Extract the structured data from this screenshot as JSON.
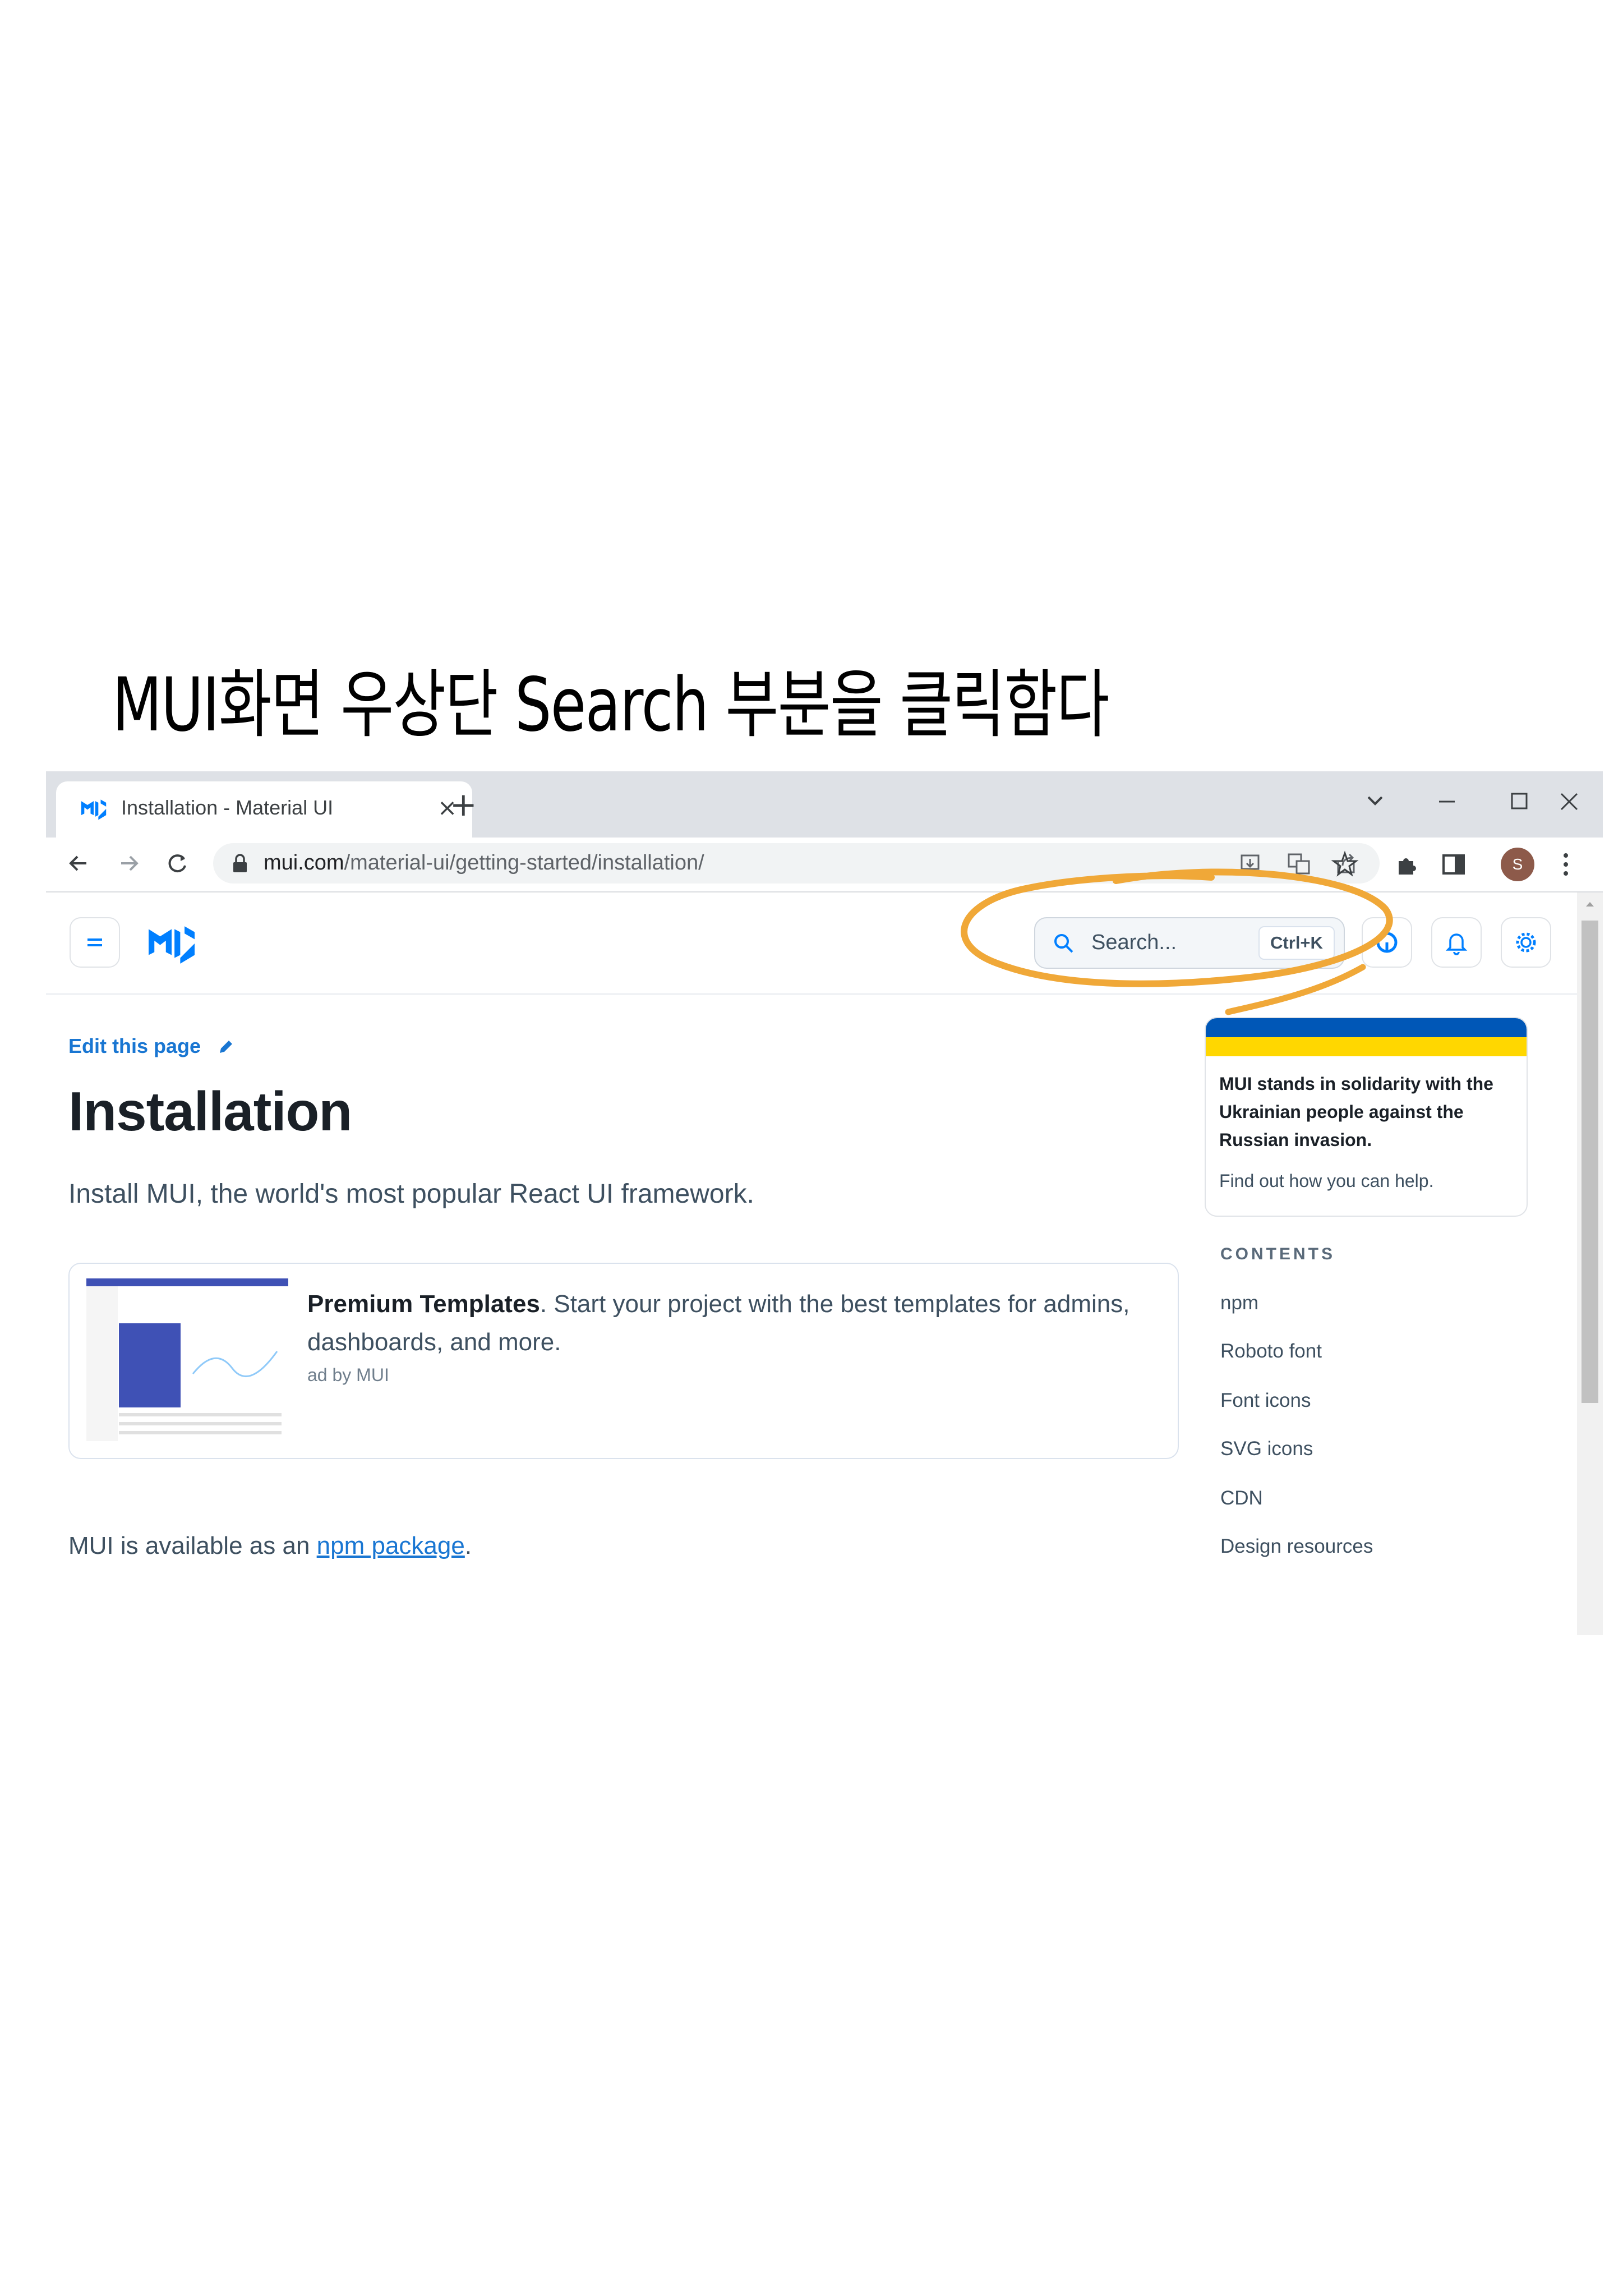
{
  "caption": "MUI화면 우상단 Search 부분을 클릭함다",
  "browser": {
    "tab_title": "Installation - Material UI",
    "tab_close": "×",
    "new_tab": "+",
    "url_host": "mui.com",
    "url_path": "/material-ui/getting-started/installation/",
    "profile_initial": "S"
  },
  "header": {
    "search_placeholder": "Search...",
    "search_shortcut": "Ctrl+K"
  },
  "main": {
    "edit_link": "Edit this page",
    "title": "Installation",
    "lead": "Install MUI, the world's most popular React UI framework.",
    "ad": {
      "headline": "Premium Templates",
      "body": ". Start your project with the best templates for admins, dashboards, and more.",
      "by": "ad by MUI"
    },
    "npm_prefix": "MUI is available as an ",
    "npm_link": "npm package",
    "npm_suffix": "."
  },
  "sidebar": {
    "banner_text": "MUI stands in solidarity with the Ukrainian people against the Russian invasion.",
    "banner_link": "Find out how you can help.",
    "toc_title": "CONTENTS",
    "toc": [
      "npm",
      "Roboto font",
      "Font icons",
      "SVG icons",
      "CDN",
      "Design resources"
    ]
  },
  "colors": {
    "accent": "#1976d2",
    "highlight": "#f0a838",
    "ukraine_blue": "#0057b7",
    "ukraine_yellow": "#ffd700"
  },
  "icons": [
    "mui-favicon",
    "close-icon",
    "plus-icon",
    "chevron-down-icon",
    "minimize-icon",
    "maximize-icon",
    "close-window-icon",
    "back-icon",
    "forward-icon",
    "reload-icon",
    "lock-icon",
    "install-icon",
    "translate-icon",
    "share-icon",
    "star-icon",
    "extensions-icon",
    "side-panel-icon",
    "avatar",
    "kebab-menu-icon",
    "hamburger-icon",
    "mui-logo",
    "search-icon",
    "github-icon",
    "bell-icon",
    "gear-icon",
    "pencil-icon"
  ]
}
